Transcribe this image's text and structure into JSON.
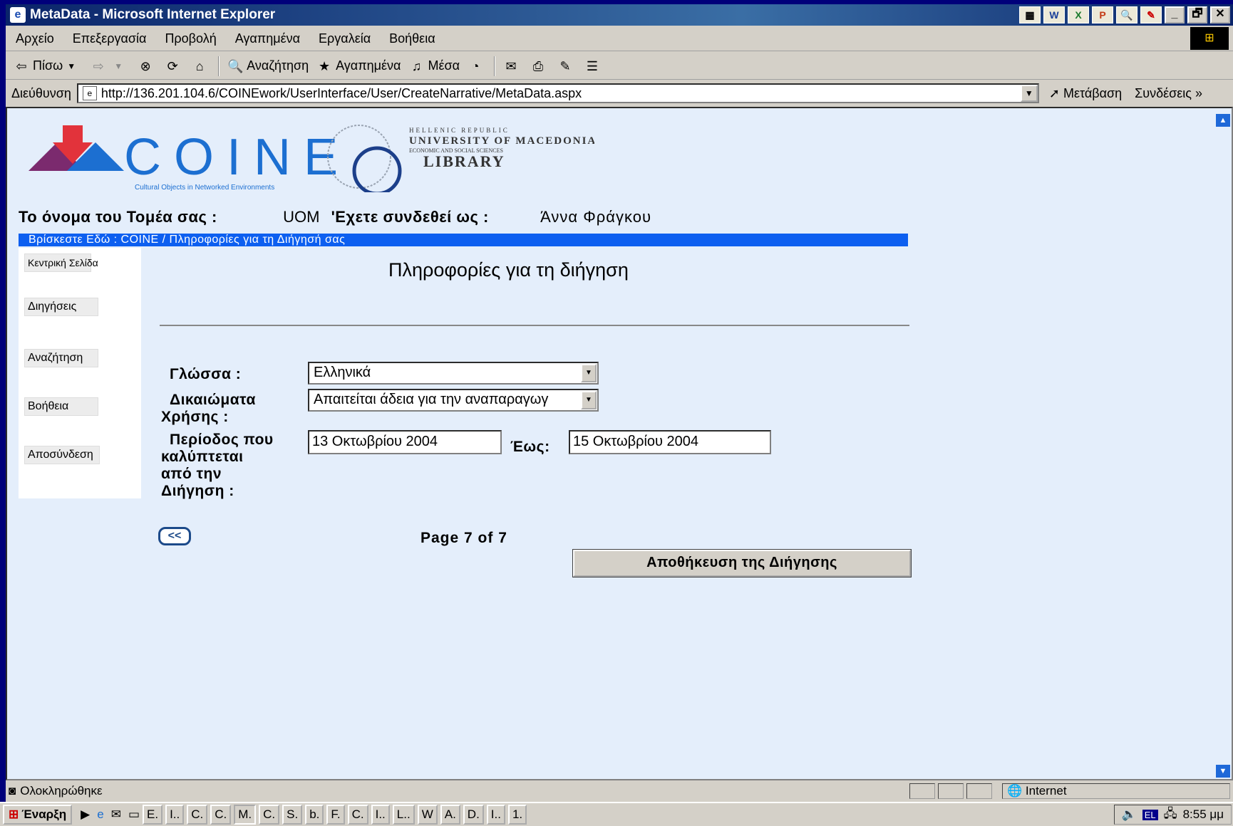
{
  "window": {
    "title": "MetaData - Microsoft Internet Explorer",
    "buttons": [
      "_",
      "🗗",
      "✕"
    ]
  },
  "menu": [
    "Αρχείο",
    "Επεξεργασία",
    "Προβολή",
    "Αγαπημένα",
    "Εργαλεία",
    "Βοήθεια"
  ],
  "toolbar": {
    "back": "Πίσω",
    "search": "Αναζήτηση",
    "favorites": "Αγαπημένα",
    "media": "Μέσα"
  },
  "address": {
    "label": "Διεύθυνση",
    "url": "http://136.201.104.6/COINEwork/UserInterface/User/CreateNarrative/MetaData.aspx",
    "go": "Μετάβαση",
    "links": "Συνδέσεις"
  },
  "header": {
    "logo_text": "COINE",
    "logo_tagline": "Cultural Objects in Networked Environments",
    "library_line1": "HELLENIC REPUBLIC",
    "library_line2": "UNIVERSITY OF MACEDONIA",
    "library_line3": "ECONOMIC AND SOCIAL SCIENCES",
    "library_line4": "LIBRARY",
    "sector_label": "Το όνομα του Τομέα σας :",
    "sector_value": "UOM",
    "user_label": "'Εχετε συνδεθεί ως :",
    "user_value": "Άννα Φράγκου",
    "breadcrumb": "Βρίσκεστε Εδώ : COINE / Πληροφορίες για τη Διήγησή σας"
  },
  "sidebar": {
    "items": [
      {
        "label": "Κεντρική Σελίδα"
      },
      {
        "label": "Διηγήσεις"
      },
      {
        "label": "Αναζήτηση"
      },
      {
        "label": "Βοήθεια"
      },
      {
        "label": "Αποσύνδεση"
      }
    ]
  },
  "form": {
    "title": "Πληροφορίες για τη διήγηση",
    "language_label": "Γλώσσα :",
    "language_value": "Ελληνικά",
    "rights_label_1": "Δικαιώματα",
    "rights_label_2": "Χρήσης :",
    "rights_value": "Απαιτείται άδεια για την αναπαραγωγ",
    "period_label_1": "Περίοδος που",
    "period_label_2": "καλύπτεται",
    "period_label_3": "από την",
    "period_label_4": "Διήγηση :",
    "period_from": "13 Οκτωβρίου 2004",
    "until_label": "Έως:",
    "period_to": "15 Οκτωβρίου 2004",
    "back_button": "<<",
    "pager": "Page  7  of  7",
    "save_button": "Αποθήκευση της Διήγησης"
  },
  "status": {
    "text": "Ολοκληρώθηκε",
    "zone": "Internet"
  },
  "taskbar": {
    "start": "Έναρξη",
    "items": [
      "E.",
      "I..",
      "C.",
      "C.",
      "M.",
      "C.",
      "S.",
      "b.",
      "F.",
      "C.",
      "I..",
      "L..",
      "W",
      "A.",
      "D.",
      "I..",
      "1."
    ],
    "lang": "EL",
    "time": "8:55 μμ"
  },
  "colors": {
    "breadcrumb_bg": "#0d5ff0",
    "page_bg": "#e4eefb",
    "logo_blue": "#1c6fd1",
    "logo_red": "#e2333b",
    "logo_purple": "#7b2a6e"
  }
}
